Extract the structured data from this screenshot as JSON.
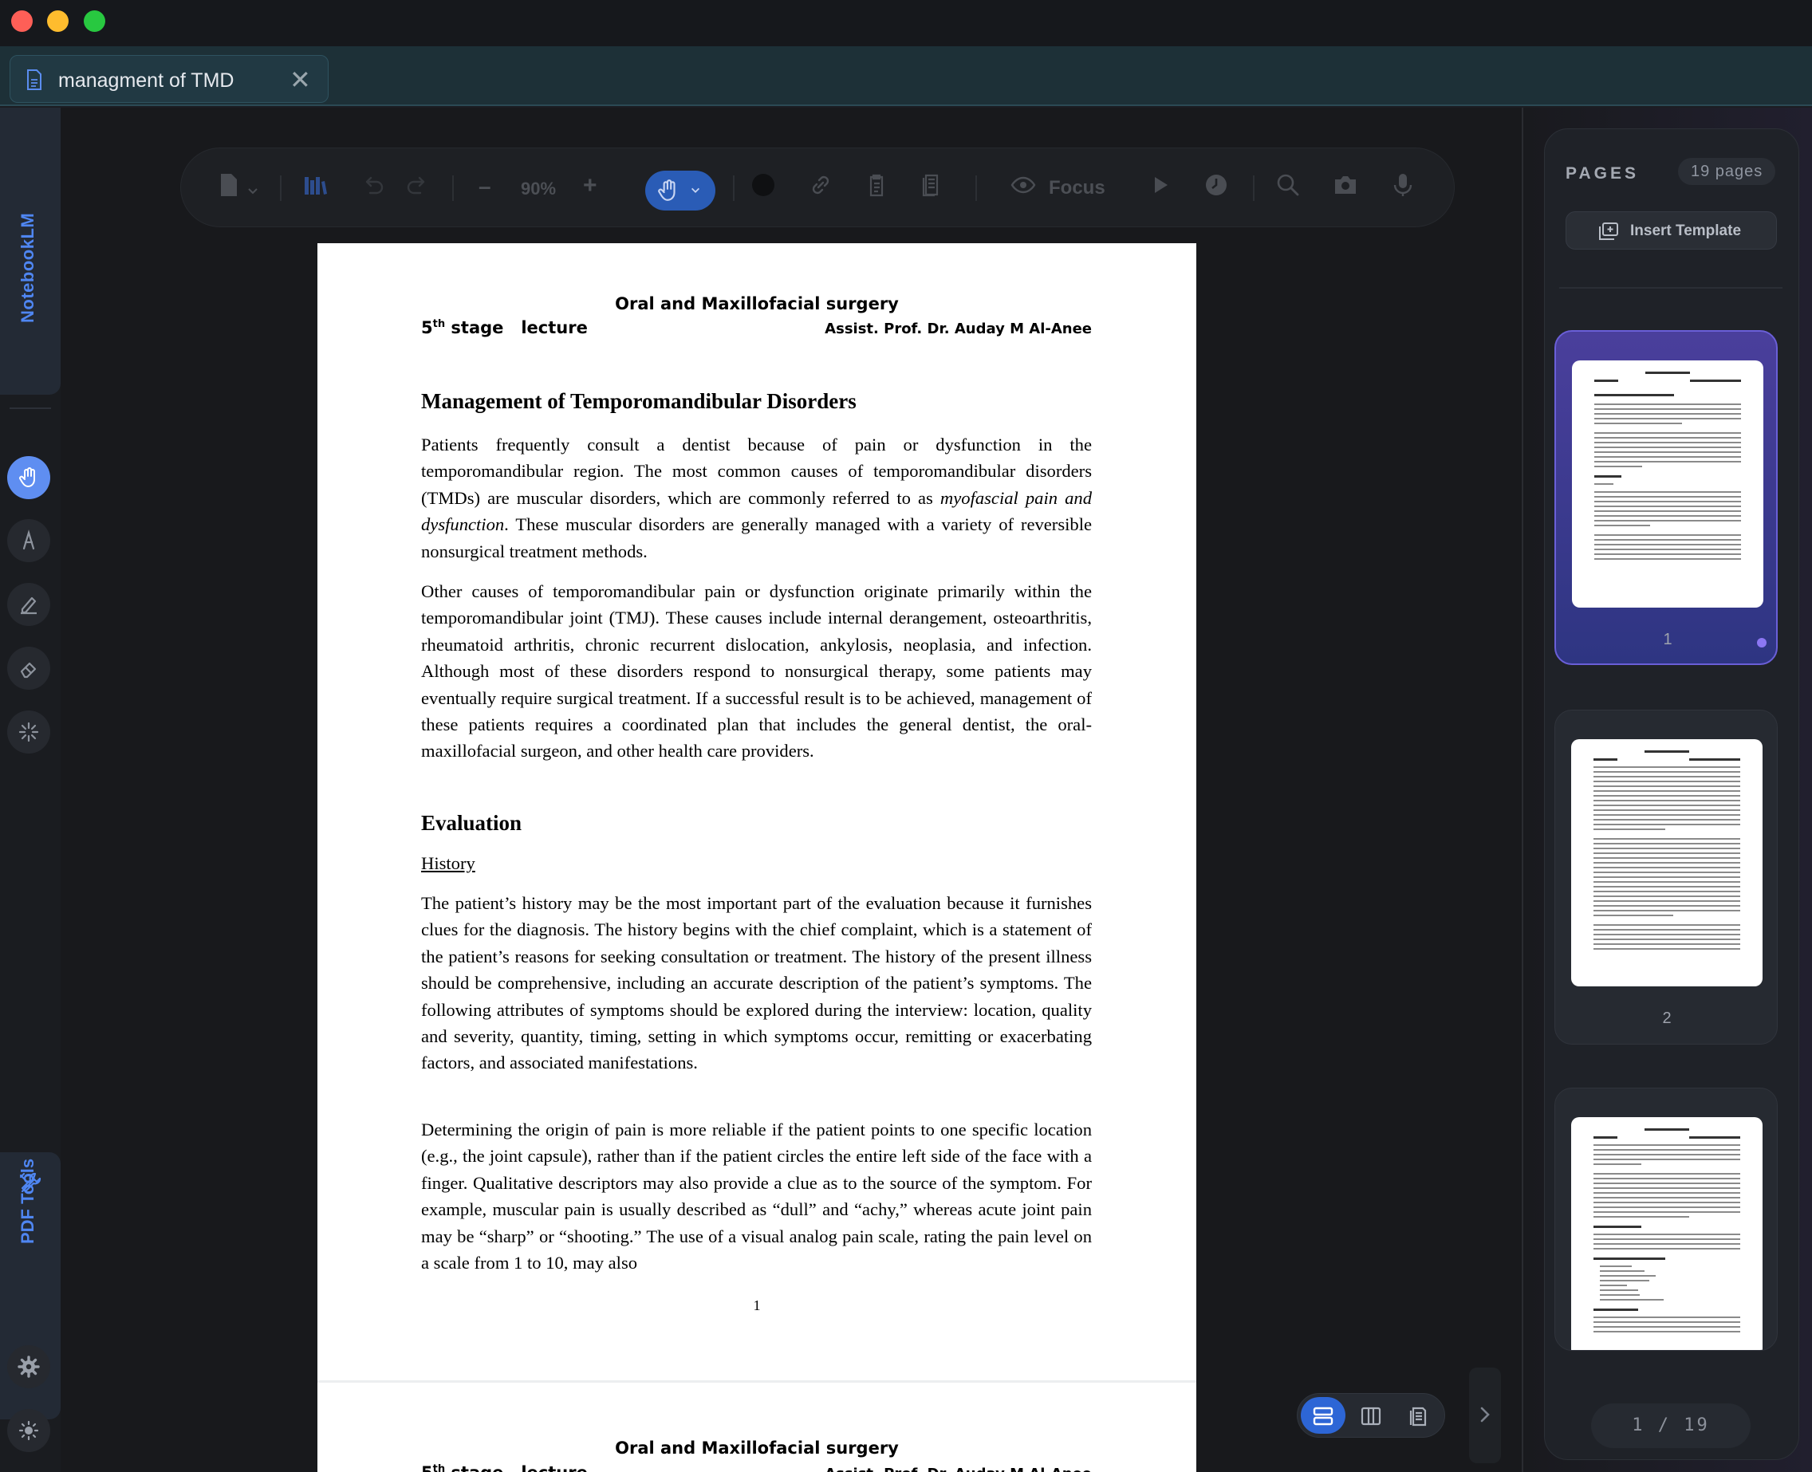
{
  "tab": {
    "title": "managment of TMD",
    "close_glyph": "✕"
  },
  "sidebar": {
    "notebook_label": "NotebookLM",
    "pdf_tools_label": "PDF Tools",
    "tools": [
      "hand-icon",
      "pen-icon",
      "highlighter-icon",
      "eraser-icon",
      "magic-icon"
    ],
    "bottom": [
      "settings-icon",
      "theme-icon"
    ]
  },
  "toolbar": {
    "zoom_minus": "–",
    "zoom_value": "90%",
    "zoom_plus": "+",
    "focus_label": "Focus"
  },
  "document": {
    "header_title": "Oral and Maxillofacial surgery",
    "header_stage_num": "5",
    "header_stage_sup": "th",
    "header_stage_rest": " stage   lecture",
    "header_author": "Assist. Prof. Dr. Auday M Al-Anee",
    "heading": "Management of Temporomandibular Disorders",
    "p1_a": "Patients frequently consult a dentist because of pain or dysfunction in the temporomandibular region. The most common causes of temporomandibular disorders (TMDs) are muscular disorders, which are commonly referred to as ",
    "p1_italic": "myofascial pain and dysfunction",
    "p1_b": ". These muscular disorders are generally managed with a variety of reversible nonsurgical treatment methods.",
    "p2": "Other causes of temporomandibular pain or dysfunction originate primarily within the temporomandibular joint (TMJ). These causes include internal derangement, osteoarthritis, rheumatoid arthritis, chronic recurrent dislocation, ankylosis, neoplasia, and infection. Although most of these disorders respond to nonsurgical therapy, some patients may eventually require surgical treatment. If a successful result is to be achieved, management of these patients requires a coordinated plan that includes the general dentist, the oral-maxillofacial surgeon, and other health care providers.",
    "heading2": "Evaluation",
    "subheading": "History",
    "p3": "The patient’s history may be the most important part of the evaluation because it furnishes clues for the diagnosis. The history begins with the chief complaint, which is a statement of the patient’s reasons for seeking consultation or treatment. The history of the present illness should be comprehensive, including an accurate description of the patient’s symptoms. The following attributes of symptoms should be explored during the interview: location, quality and severity, quantity, timing, setting in which symptoms occur, remitting or exacerbating factors, and associated manifestations.",
    "p4": "Determining the origin of pain is more reliable if the patient points to one specific location (e.g., the joint capsule), rather than if the patient circles the entire left side of the face with a finger. Qualitative descriptors may also provide a clue as to the source of the symptom. For example, muscular pain is usually described as “dull” and “achy,” whereas acute joint pain may be “sharp” or “shooting.” The use of a visual analog pain scale, rating the pain level on a scale from 1 to 10, may also",
    "page_number": "1",
    "page2_header_title": "Oral and Maxillofacial surgery",
    "page2_stage_num": "5",
    "page2_stage_sup": "th",
    "page2_stage_rest": " stage   lecture",
    "page2_author": "Assist. Prof. Dr. Auday M Al-Anee"
  },
  "pages_panel": {
    "title": "PAGES",
    "count": "19 pages",
    "insert_label": "Insert Template",
    "thumbs": [
      {
        "number": "1"
      },
      {
        "number": "2"
      }
    ],
    "pager": "1 / 19"
  },
  "colors": {
    "accent": "#5f8ef1",
    "active_thumb": "#4a3f9c",
    "label_blue": "#4f86f2"
  }
}
